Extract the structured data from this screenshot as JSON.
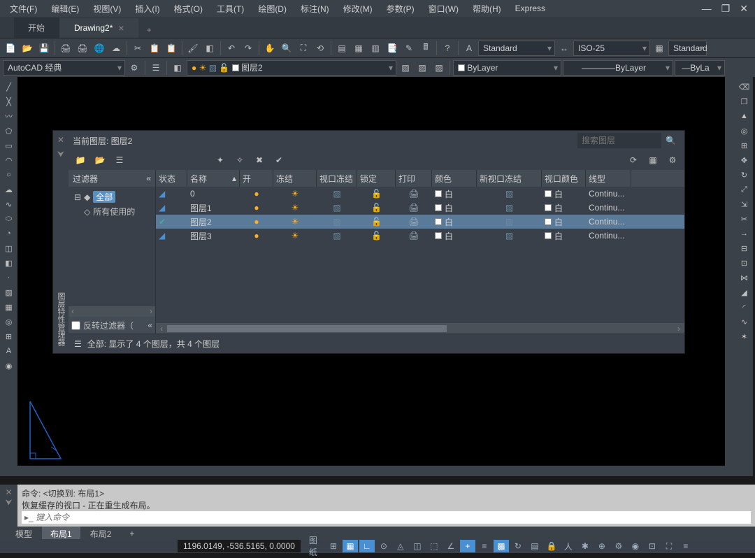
{
  "menu": [
    "文件(F)",
    "编辑(E)",
    "视图(V)",
    "插入(I)",
    "格式(O)",
    "工具(T)",
    "绘图(D)",
    "标注(N)",
    "修改(M)",
    "参数(P)",
    "窗口(W)",
    "帮助(H)",
    "Express"
  ],
  "tabs": {
    "start": "开始",
    "drawing": "Drawing2*"
  },
  "toolbar": {
    "workspace": "AutoCAD 经典",
    "layer_current": "图层2",
    "text_style": "Standard",
    "dim_style": "ISO-25",
    "table_style": "Standard",
    "bylayer": "ByLayer",
    "ls_bylayer": "ByLayer",
    "lw_bylayer": "ByLa"
  },
  "layer_panel": {
    "title": "当前图层: 图层2",
    "search_placeholder": "搜索图层",
    "vtitle": "图层特性管理器",
    "filter_header": "过滤器",
    "filter_all": "全部",
    "filter_used": "所有使用的",
    "filter_invert": "反转过滤器（",
    "status_text": "全部: 显示了 4 个图层，共 4 个图层",
    "columns": {
      "status": "状态",
      "name": "名称",
      "on": "开",
      "freeze": "冻结",
      "vpfreeze": "视口冻结",
      "lock": "锁定",
      "plot": "打印",
      "color": "颜色",
      "nvpfreeze": "新视口冻结",
      "vpcolor": "视口颜色",
      "linetype": "线型"
    },
    "rows": [
      {
        "name": "0",
        "color": "白",
        "linetype": "Continu...",
        "current": false
      },
      {
        "name": "图层1",
        "color": "白",
        "linetype": "Continu...",
        "current": false
      },
      {
        "name": "图层2",
        "color": "白",
        "linetype": "Continu...",
        "current": true
      },
      {
        "name": "图层3",
        "color": "白",
        "linetype": "Continu...",
        "current": false
      }
    ]
  },
  "cmdline": {
    "line1": "命令:     <切换到:  布局1>",
    "line2": "恢复缓存的视口  -  正在重生成布局。",
    "placeholder": "键入命令"
  },
  "bottom_tabs": {
    "model": "模型",
    "layout1": "布局1",
    "layout2": "布局2"
  },
  "statusbar": {
    "coords": "1196.0149, -536.5165, 0.0000",
    "paper": "图纸"
  }
}
